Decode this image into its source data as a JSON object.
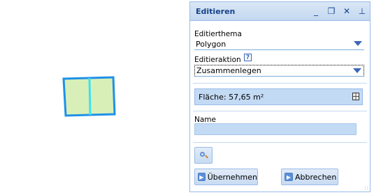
{
  "panel": {
    "title": "Editieren",
    "tools": {
      "minimize": "minimize-icon",
      "restore": "restore-icon",
      "close": "close-icon",
      "pin": "pin-icon"
    }
  },
  "theme": {
    "label": "Editierthema",
    "value": "Polygon"
  },
  "action": {
    "label": "Editieraktion",
    "help": "?",
    "value": "Zusammenlegen"
  },
  "area": {
    "text": "Fläche: 57,65 m²"
  },
  "name": {
    "label": "Name",
    "value": ""
  },
  "buttons": {
    "accept": "Übernehmen",
    "cancel": "Abbrechen"
  },
  "colors": {
    "polygon_fill": "#d8f0b8",
    "polygon_stroke": "#1e90e8",
    "split_line": "#40e0f0",
    "header_text": "#15428b"
  }
}
